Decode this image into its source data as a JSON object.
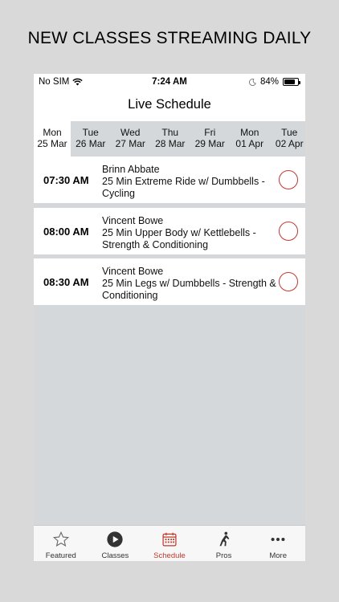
{
  "headline": "NEW CLASSES STREAMING DAILY",
  "status_bar": {
    "carrier": "No SIM",
    "time": "7:24 AM",
    "battery": "84%",
    "battery_level": 0.84
  },
  "nav": {
    "title": "Live Schedule"
  },
  "days": [
    {
      "weekday": "Mon",
      "date": "25 Mar",
      "selected": true
    },
    {
      "weekday": "Tue",
      "date": "26 Mar"
    },
    {
      "weekday": "Wed",
      "date": "27 Mar"
    },
    {
      "weekday": "Thu",
      "date": "28 Mar"
    },
    {
      "weekday": "Fri",
      "date": "29 Mar"
    },
    {
      "weekday": "Mon",
      "date": "01 Apr"
    },
    {
      "weekday": "Tue",
      "date": "02 Apr"
    }
  ],
  "classes": [
    {
      "time": "07:30 AM",
      "instructor": "Brinn Abbate",
      "title": "25 Min Extreme Ride w/ Dumbbells - Cycling"
    },
    {
      "time": "08:00 AM",
      "instructor": "Vincent Bowe",
      "title": "25 Min Upper Body w/ Kettlebells - Strength & Conditioning"
    },
    {
      "time": "08:30 AM",
      "instructor": "Vincent Bowe",
      "title": "25 Min Legs w/ Dumbbells - Strength & Conditioning"
    }
  ],
  "tabs": [
    {
      "label": "Featured",
      "icon": "star-icon"
    },
    {
      "label": "Classes",
      "icon": "play-icon"
    },
    {
      "label": "Schedule",
      "icon": "calendar-icon",
      "active": true
    },
    {
      "label": "Pros",
      "icon": "pros-icon"
    },
    {
      "label": "More",
      "icon": "more-icon"
    }
  ],
  "colors": {
    "accent": "#c0392b",
    "background": "#d9d9d9",
    "list_background": "#d4d8da"
  }
}
